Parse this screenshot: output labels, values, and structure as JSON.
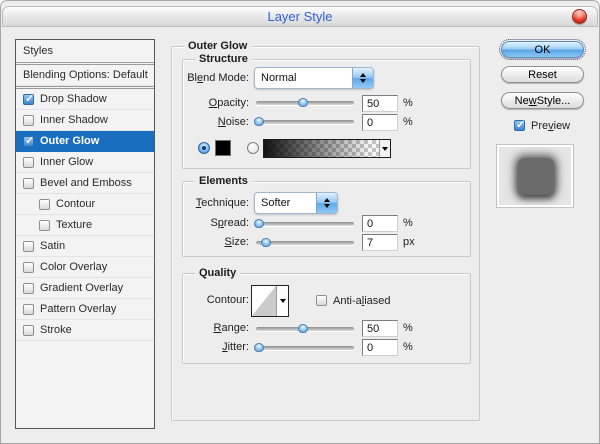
{
  "window": {
    "title": "Layer Style"
  },
  "colors": {
    "selection_blue": "#1a6ebf",
    "aqua_blue": "#5ea7ea",
    "title_text": "#2e5edb",
    "glow_swatch": "#000000"
  },
  "sidebar": {
    "header": "Styles",
    "items": [
      {
        "label": "Blending Options: Default",
        "checkbox": false,
        "checked": false,
        "selected": false
      },
      {
        "label": "Drop Shadow",
        "checkbox": true,
        "checked": true,
        "selected": false
      },
      {
        "label": "Inner Shadow",
        "checkbox": true,
        "checked": false,
        "selected": false
      },
      {
        "label": "Outer Glow",
        "checkbox": true,
        "checked": true,
        "selected": true
      },
      {
        "label": "Inner Glow",
        "checkbox": true,
        "checked": false,
        "selected": false
      },
      {
        "label": "Bevel and Emboss",
        "checkbox": true,
        "checked": false,
        "selected": false
      },
      {
        "label": "Contour",
        "checkbox": true,
        "checked": false,
        "selected": false,
        "indent": true
      },
      {
        "label": "Texture",
        "checkbox": true,
        "checked": false,
        "selected": false,
        "indent": true
      },
      {
        "label": "Satin",
        "checkbox": true,
        "checked": false,
        "selected": false
      },
      {
        "label": "Color Overlay",
        "checkbox": true,
        "checked": false,
        "selected": false
      },
      {
        "label": "Gradient Overlay",
        "checkbox": true,
        "checked": false,
        "selected": false
      },
      {
        "label": "Pattern Overlay",
        "checkbox": true,
        "checked": false,
        "selected": false
      },
      {
        "label": "Stroke",
        "checkbox": true,
        "checked": false,
        "selected": false
      }
    ]
  },
  "panel": {
    "title": "Outer Glow",
    "structure": {
      "legend": "Structure",
      "blend_mode": {
        "label": "Blend Mode:",
        "value": "Normal"
      },
      "opacity": {
        "label": "Opacity:",
        "value": "50",
        "unit": "%",
        "slider_pct": 48
      },
      "noise": {
        "label": "Noise:",
        "value": "0",
        "unit": "%",
        "slider_pct": 3
      },
      "color_swatch": "#000000"
    },
    "elements": {
      "legend": "Elements",
      "technique": {
        "label": "Technique:",
        "value": "Softer"
      },
      "spread": {
        "label": "Spread:",
        "value": "0",
        "unit": "%",
        "slider_pct": 3
      },
      "size": {
        "label": "Size:",
        "value": "7",
        "unit": "px",
        "slider_pct": 10
      }
    },
    "quality": {
      "legend": "Quality",
      "contour": {
        "label": "Contour:"
      },
      "anti_aliased": {
        "label": "Anti-aliased",
        "checked": false
      },
      "range": {
        "label": "Range:",
        "value": "50",
        "unit": "%",
        "slider_pct": 48
      },
      "jitter": {
        "label": "Jitter:",
        "value": "0",
        "unit": "%",
        "slider_pct": 3
      }
    }
  },
  "actions": {
    "ok": "OK",
    "reset": "Reset",
    "new_style": "New Style...",
    "preview": "Preview",
    "preview_checked": true
  }
}
